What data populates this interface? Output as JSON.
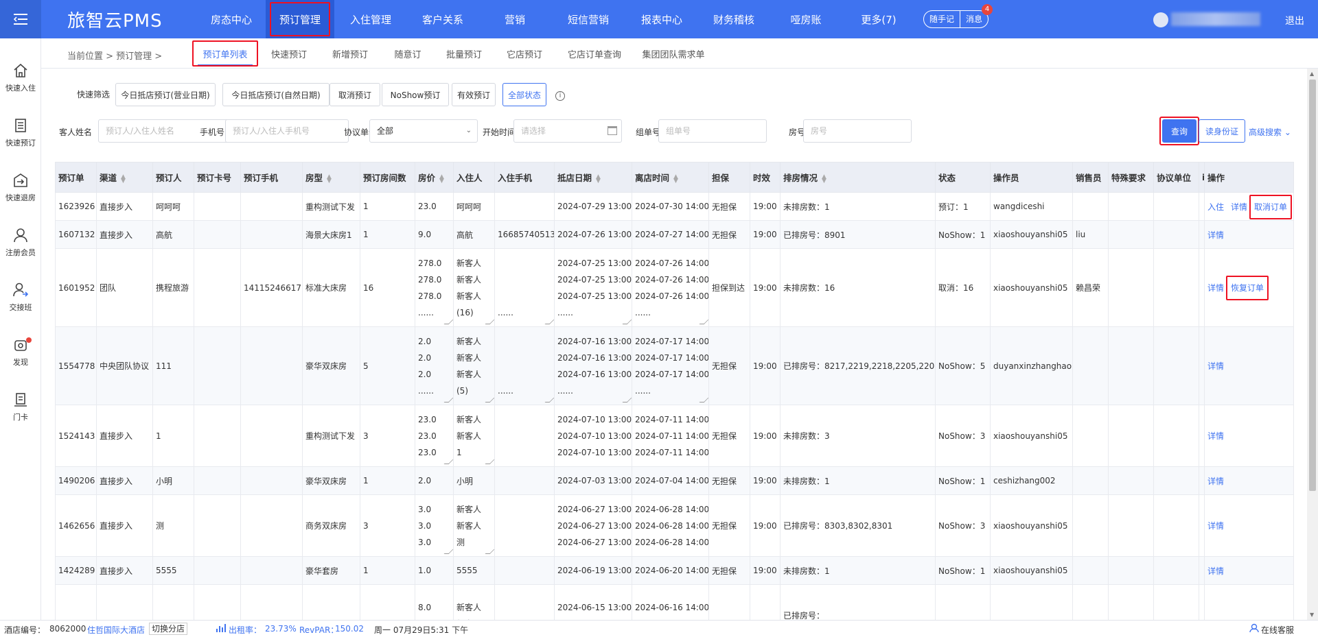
{
  "brand": "旅智云PMS",
  "nav": [
    "房态中心",
    "预订管理",
    "入住管理",
    "客户关系",
    "营销",
    "短信营销",
    "报表中心",
    "财务稽核",
    "哑房账",
    "更多(7)"
  ],
  "nav_active": 1,
  "top_right": {
    "memo": "随手记",
    "messages": "消息",
    "message_count": "4",
    "logout": "退出"
  },
  "sidebar": [
    "快速入住",
    "快速预订",
    "快速退房",
    "注册会员",
    "交接班",
    "发现",
    "门卡"
  ],
  "breadcrumb": "当前位置 > 预订管理 >",
  "subtabs": [
    "预订单列表",
    "快速预订",
    "新增预订",
    "随意订",
    "批量预订",
    "它店预订",
    "它店订单查询",
    "集团团队需求单"
  ],
  "subtab_active": 0,
  "quick_filter": {
    "label": "快速筛选",
    "chips": [
      "今日抵店预订(营业日期)",
      "今日抵店预订(自然日期)",
      "取消预订",
      "NoShow预订",
      "有效预订",
      "全部状态"
    ],
    "active": 5
  },
  "search": {
    "guest_name": {
      "label": "客人姓名",
      "placeholder": "预订人/入住人姓名"
    },
    "phone": {
      "label": "手机号",
      "placeholder": "预订人/入住人手机号"
    },
    "agreement": {
      "label": "协议单位",
      "value": "全部"
    },
    "start_time": {
      "label": "开始时间",
      "placeholder": "请选择"
    },
    "group_no": {
      "label": "组单号",
      "placeholder": "组单号"
    },
    "room_no": {
      "label": "房号",
      "placeholder": "房号"
    },
    "query_btn": "查询",
    "id_btn": "读身份证",
    "advanced": "高级搜索"
  },
  "table": {
    "headers": [
      "预订单",
      "渠道",
      "预订人",
      "预订卡号",
      "预订手机",
      "房型",
      "预订房间数",
      "房价",
      "入住人",
      "入住手机",
      "抵店日期",
      "离店时间",
      "担保",
      "时效",
      "排房情况",
      "状态",
      "操作员",
      "销售员",
      "特殊要求",
      "协议单位",
      "i",
      "操作"
    ],
    "rows": [
      {
        "id": "1623926",
        "channel": "直接步入",
        "booker": "呵呵呵",
        "card": "",
        "phone": "",
        "room_type": "重构测试下发",
        "count": "1",
        "price": [
          "23.0"
        ],
        "guest": [
          "呵呵呵"
        ],
        "guest_phone": [
          ""
        ],
        "arrive": [
          "2024-07-29 13:00"
        ],
        "depart": [
          "2024-07-30 14:00"
        ],
        "guarantee": "无担保",
        "hold": "19:00",
        "assign": "未排房数：1",
        "status": "预订：1",
        "operator": "wangdiceshi",
        "sales": "",
        "actions": [
          "入住",
          "详情",
          "取消订单"
        ],
        "hl": 2
      },
      {
        "id": "1607132",
        "channel": "直接步入",
        "booker": "高航",
        "card": "",
        "phone": "",
        "room_type": "海景大床房1",
        "count": "1",
        "price": [
          "9.0"
        ],
        "guest": [
          "高航"
        ],
        "guest_phone": [
          "16685740513"
        ],
        "arrive": [
          "2024-07-26 13:00"
        ],
        "depart": [
          "2024-07-27 14:00"
        ],
        "guarantee": "无担保",
        "hold": "19:00",
        "assign": "已排房号：8901",
        "status": "NoShow：1",
        "operator": "xiaoshouyanshi05",
        "sales": "liu",
        "actions": [
          "详情"
        ],
        "hl": -1
      },
      {
        "id": "1601952",
        "channel": "团队",
        "booker": "携程旅游",
        "card": "",
        "phone": "14115246617",
        "room_type": "标准大床房",
        "count": "16",
        "price": [
          "278.0",
          "278.0",
          "278.0",
          "......"
        ],
        "guest": [
          "新客人",
          "新客人",
          "新客人",
          "(16)"
        ],
        "guest_phone": [
          "",
          "",
          "",
          "......"
        ],
        "arrive": [
          "2024-07-25 13:00",
          "2024-07-25 13:00",
          "2024-07-25 13:00",
          "......"
        ],
        "depart": [
          "2024-07-26 14:00",
          "2024-07-26 14:00",
          "2024-07-26 14:00",
          "......"
        ],
        "guarantee": "担保到达",
        "hold": "19:00",
        "assign": "未排房数：16",
        "status": "取消：16",
        "operator": "xiaoshouyanshi05",
        "sales": "赖昌荣",
        "actions": [
          "详情",
          "恢复订单"
        ],
        "hl": 1
      },
      {
        "id": "1554778",
        "channel": "中央团队协议",
        "booker": "111",
        "card": "",
        "phone": "",
        "room_type": "豪华双床房",
        "count": "5",
        "price": [
          "2.0",
          "2.0",
          "2.0",
          "......"
        ],
        "guest": [
          "新客人",
          "新客人",
          "新客人",
          "(5)"
        ],
        "guest_phone": [
          "",
          "",
          "",
          "......"
        ],
        "arrive": [
          "2024-07-16 13:00",
          "2024-07-16 13:00",
          "2024-07-16 13:00",
          "......"
        ],
        "depart": [
          "2024-07-17 14:00",
          "2024-07-17 14:00",
          "2024-07-17 14:00",
          "......"
        ],
        "guarantee": "无担保",
        "hold": "19:00",
        "assign": "已排房号：8217,2219,2218,2205,2202",
        "status": "NoShow：5",
        "operator": "duyanxinzhanghao",
        "sales": "",
        "actions": [
          "详情"
        ],
        "hl": -1
      },
      {
        "id": "1524143",
        "channel": "直接步入",
        "booker": "1",
        "card": "",
        "phone": "",
        "room_type": "重构测试下发",
        "count": "3",
        "price": [
          "23.0",
          "23.0",
          "23.0"
        ],
        "guest": [
          "新客人",
          "新客人",
          "1"
        ],
        "guest_phone": [
          ""
        ],
        "arrive": [
          "2024-07-10 13:00",
          "2024-07-10 13:00",
          "2024-07-10 13:00"
        ],
        "depart": [
          "2024-07-11 14:00",
          "2024-07-11 14:00",
          "2024-07-11 14:00"
        ],
        "guarantee": "无担保",
        "hold": "19:00",
        "assign": "未排房数：3",
        "status": "NoShow：3",
        "operator": "xiaoshouyanshi05",
        "sales": "",
        "actions": [
          "详情"
        ],
        "hl": -1
      },
      {
        "id": "1490206",
        "channel": "直接步入",
        "booker": "小明",
        "card": "",
        "phone": "",
        "room_type": "豪华双床房",
        "count": "1",
        "price": [
          "2.0"
        ],
        "guest": [
          "小明"
        ],
        "guest_phone": [
          ""
        ],
        "arrive": [
          "2024-07-03 13:00"
        ],
        "depart": [
          "2024-07-04 14:00"
        ],
        "guarantee": "无担保",
        "hold": "19:00",
        "assign": "未排房数：1",
        "status": "NoShow：1",
        "operator": "ceshizhang002",
        "sales": "",
        "actions": [
          "详情"
        ],
        "hl": -1
      },
      {
        "id": "1462656",
        "channel": "直接步入",
        "booker": "测",
        "card": "",
        "phone": "",
        "room_type": "商务双床房",
        "count": "3",
        "price": [
          "3.0",
          "3.0",
          "3.0"
        ],
        "guest": [
          "新客人",
          "新客人",
          "测"
        ],
        "guest_phone": [
          ""
        ],
        "arrive": [
          "2024-06-27 13:00",
          "2024-06-27 13:00",
          "2024-06-27 13:00"
        ],
        "depart": [
          "2024-06-28 14:00",
          "2024-06-28 14:00",
          "2024-06-28 14:00"
        ],
        "guarantee": "无担保",
        "hold": "19:00",
        "assign": "已排房号：8303,8302,8301",
        "status": "NoShow：3",
        "operator": "xiaoshouyanshi05",
        "sales": "",
        "actions": [
          "详情"
        ],
        "hl": -1
      },
      {
        "id": "1424289",
        "channel": "直接步入",
        "booker": "5555",
        "card": "",
        "phone": "",
        "room_type": "豪华套房",
        "count": "1",
        "price": [
          "1.0"
        ],
        "guest": [
          "5555"
        ],
        "guest_phone": [
          ""
        ],
        "arrive": [
          "2024-06-19 13:00"
        ],
        "depart": [
          "2024-06-20 14:00"
        ],
        "guarantee": "无担保",
        "hold": "19:00",
        "assign": "未排房数：1",
        "status": "NoShow：1",
        "operator": "xiaoshouyanshi05",
        "sales": "",
        "actions": [
          "详情"
        ],
        "hl": -1
      },
      {
        "id": "",
        "channel": "",
        "booker": "",
        "card": "",
        "phone": "",
        "room_type": "",
        "count": "",
        "price": [
          "8.0",
          "8.0"
        ],
        "guest": [
          "新客人",
          "新客人"
        ],
        "guest_phone": [
          ""
        ],
        "arrive": [
          "2024-06-15 13:00",
          "2024-06-15 13:00"
        ],
        "depart": [
          "2024-06-16 14:00",
          "2024-06-16 14:00"
        ],
        "guarantee": "",
        "hold": "",
        "assign": "已排房号：",
        "status": "",
        "operator": "",
        "sales": "",
        "actions": [],
        "hl": -1
      }
    ]
  },
  "statusbar": {
    "hotel_code_label": "酒店编号：",
    "hotel_code": "8062000",
    "hotel_name": "住哲国际大酒店",
    "switch": "切换分店",
    "occupancy_label": "出租率：",
    "occupancy": "23.73%",
    "revpar_label": "RevPAR：",
    "revpar": "150.02",
    "datetime": "周一 07月29日5:31 下午",
    "support": "在线客服"
  }
}
